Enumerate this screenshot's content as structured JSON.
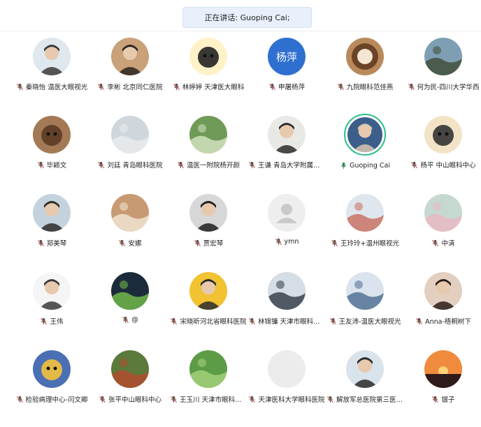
{
  "banner": {
    "text": "正在讲话: Guoping Cai;"
  },
  "participants": [
    {
      "name": "秦晓怡 温医大眼视光",
      "avatar": "photo-woman-doctor",
      "mic": "muted",
      "bg": "#dfe7ef",
      "fg": "#3a3a3a"
    },
    {
      "name": "李彬 北京同仁医院",
      "avatar": "photo-woman-office",
      "mic": "muted",
      "bg": "#c9a27a",
      "fg": "#2b2420"
    },
    {
      "name": "林婷婷 天津医大眼科",
      "avatar": "cartoon-panda-jiayou",
      "mic": "muted",
      "bg": "#fff2c9",
      "fg": "#222222"
    },
    {
      "name": "申屠杨萍",
      "avatar": "text-avatar",
      "avatar_text": "杨萍",
      "mic": "muted",
      "bg": "#2f6fd0",
      "fg": "#ffffff"
    },
    {
      "name": "九院眼科范佳燕",
      "avatar": "photo-latte-art",
      "mic": "muted",
      "bg": "#b88a5b",
      "fg": "#f4e6d2"
    },
    {
      "name": "何为民-四川大学华西",
      "avatar": "photo-mountain",
      "mic": "muted",
      "bg": "#7e9fb3",
      "fg": "#3e4a34"
    },
    {
      "name": "毕颖文",
      "avatar": "cartoon-baby",
      "mic": "muted",
      "bg": "#a37a55",
      "fg": "#5b3b24"
    },
    {
      "name": "刘廷 青岛眼科医院",
      "avatar": "photo-sky",
      "mic": "muted",
      "bg": "#cfd6dc",
      "fg": "#e8ecef"
    },
    {
      "name": "温医一附院杨开颜",
      "avatar": "photo-garden",
      "mic": "muted",
      "bg": "#6f9a57",
      "fg": "#d7e6c4"
    },
    {
      "name": "王谦 青岛大学附属医院",
      "avatar": "photo-woman-white",
      "mic": "muted",
      "bg": "#e8e9e4",
      "fg": "#2c2c2c"
    },
    {
      "name": "Guoping Cai",
      "avatar": "photo-man-suit",
      "mic": "speaking",
      "bg": "#3b5f8a",
      "fg": "#d9c6b2"
    },
    {
      "name": "杨平 中山眼科中心",
      "avatar": "cartoon-dog",
      "mic": "muted",
      "bg": "#f3e3c6",
      "fg": "#333333"
    },
    {
      "name": "郑美琴",
      "avatar": "photo-woman-coat",
      "mic": "muted",
      "bg": "#c4d2de",
      "fg": "#2a2a2a"
    },
    {
      "name": "安娜",
      "avatar": "photo-flowers-hat",
      "mic": "muted",
      "bg": "#c79a73",
      "fg": "#f3e7d6"
    },
    {
      "name": "贾宏琴",
      "avatar": "photo-bw-girl",
      "mic": "muted",
      "bg": "#d7d7d7",
      "fg": "#1f1f1f"
    },
    {
      "name": "ymn",
      "avatar": "default-user",
      "mic": "muted",
      "bg": "#eeeeee",
      "fg": "#c9c9c9"
    },
    {
      "name": "王玲玲+温州眼视光",
      "avatar": "photo-dolls",
      "mic": "muted",
      "bg": "#dfe6ee",
      "fg": "#c86b5c"
    },
    {
      "name": "中清",
      "avatar": "photo-flower-cup",
      "mic": "muted",
      "bg": "#c6d9d0",
      "fg": "#eab7c1"
    },
    {
      "name": "王伟",
      "avatar": "sketch-man",
      "mic": "muted",
      "bg": "#f5f5f5",
      "fg": "#3b3b3b"
    },
    {
      "name": "@",
      "avatar": "photo-leaves",
      "mic": "muted",
      "bg": "#1c2b3c",
      "fg": "#77c04a"
    },
    {
      "name": "宋晓昕河北省眼科医院",
      "avatar": "photo-woman-yellow",
      "mic": "muted",
      "bg": "#f1c232",
      "fg": "#2b2b2b"
    },
    {
      "name": "林锦镛 天津市眼科医院",
      "avatar": "photo-microscope",
      "mic": "muted",
      "bg": "#d6dde4",
      "fg": "#2e3a45"
    },
    {
      "name": "王友沛-温医大眼视光",
      "avatar": "photo-rail",
      "mic": "muted",
      "bg": "#dbe4ee",
      "fg": "#4a6c8f"
    },
    {
      "name": "Anna-梧桐树下",
      "avatar": "photo-woman-dark",
      "mic": "muted",
      "bg": "#e3cfc0",
      "fg": "#2a1d17"
    },
    {
      "name": "检验病理中心-闫文卿",
      "avatar": "cartoon-star",
      "mic": "muted",
      "bg": "#4a6fb3",
      "fg": "#f3c23b"
    },
    {
      "name": "张平中山眼科中心",
      "avatar": "photo-lake",
      "mic": "muted",
      "bg": "#5b7a3b",
      "fg": "#b8482e"
    },
    {
      "name": "王玉川 天津市眼科医院",
      "avatar": "photo-green-leaves",
      "mic": "muted",
      "bg": "#5d9c46",
      "fg": "#a8d57d"
    },
    {
      "name": "天津医科大学眼科医院",
      "avatar": "blank",
      "mic": "muted",
      "bg": "#ececec",
      "fg": "#ececec"
    },
    {
      "name": "解放军总医院第三医学中心",
      "avatar": "photo-woman-mask",
      "mic": "muted",
      "bg": "#d9e3ec",
      "fg": "#2a2a2a"
    },
    {
      "name": "银子",
      "avatar": "photo-sunset",
      "mic": "muted",
      "bg": "#f08a3c",
      "fg": "#2f1b1b"
    }
  ]
}
